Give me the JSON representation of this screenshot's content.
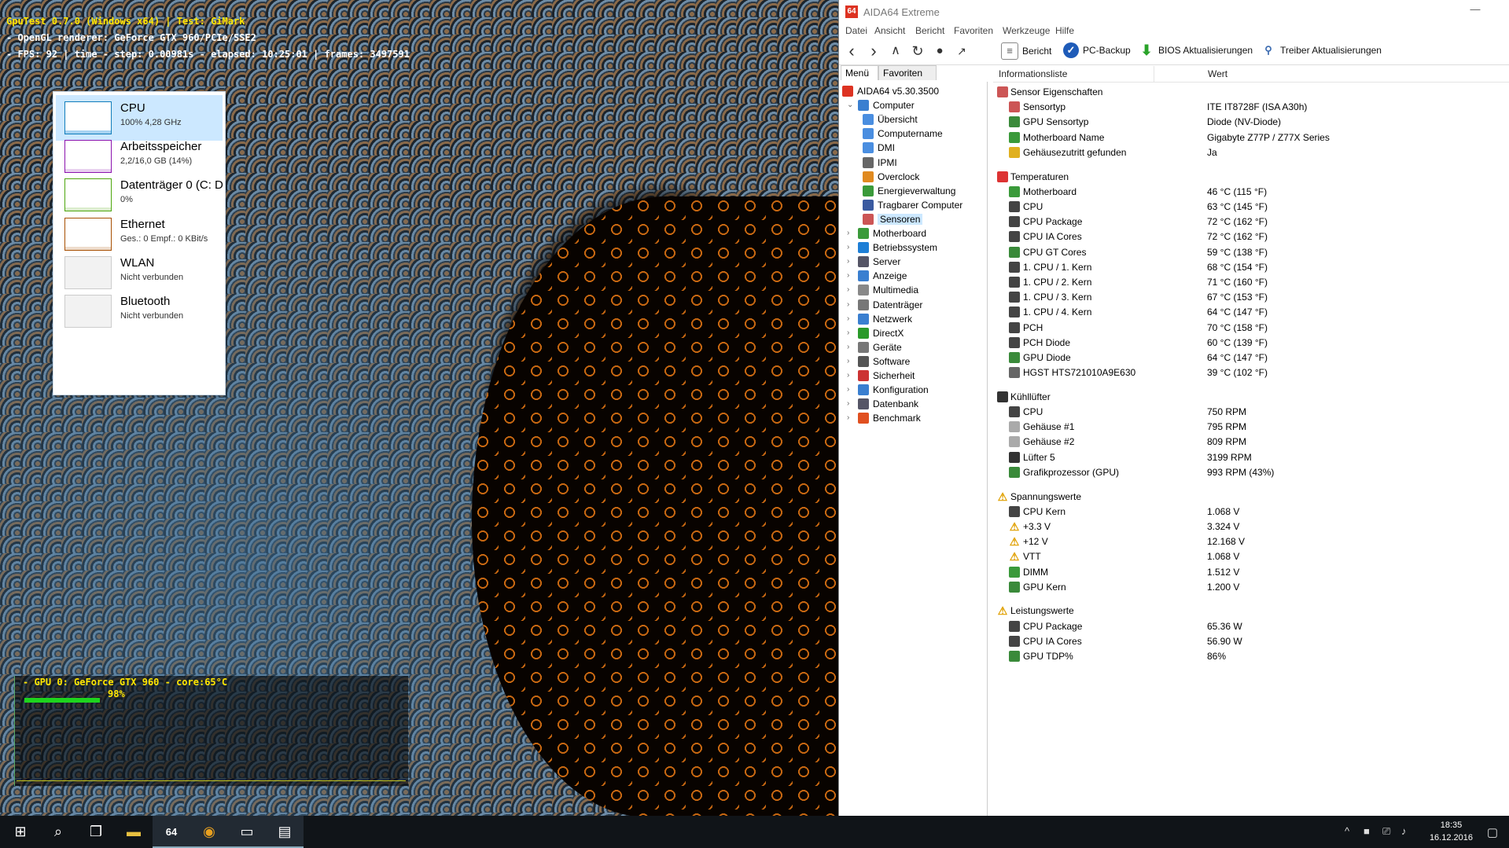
{
  "gputest": {
    "title": "GpuTest 0.7.0 (Windows x64) | Test: GiMark",
    "renderer": "- OpenGL renderer: GeForce GTX 960/PCIe/SSE2",
    "stats": "- FPS: 92 | time - step: 0.00981s - elapsed: 10:25:01 | frames: 3497591",
    "gpu_label": "- GPU 0: GeForce GTX 960 - core:65°C",
    "gpu_percent_text": "98%",
    "gpu_load": 0.98,
    "colors": {
      "osd_title": "#ffe600",
      "gpu_bar": "#1ed41e"
    }
  },
  "taskmgr": {
    "items": [
      {
        "name": "CPU",
        "sub": "100% 4,28 GHz",
        "color": "#117dbb",
        "selected": true
      },
      {
        "name": "Arbeitsspeicher",
        "sub": "2,2/16,0 GB (14%)",
        "color": "#8b12ae",
        "selected": false
      },
      {
        "name": "Datenträger 0 (C: D",
        "sub": "0%",
        "color": "#4da60c",
        "selected": false
      },
      {
        "name": "Ethernet",
        "sub": "Ges.: 0 Empf.: 0 KBit/s",
        "color": "#a74f01",
        "selected": false
      },
      {
        "name": "WLAN",
        "sub": "Nicht verbunden",
        "color": "#cccccc",
        "selected": false
      },
      {
        "name": "Bluetooth",
        "sub": "Nicht verbunden",
        "color": "#cccccc",
        "selected": false
      }
    ]
  },
  "aida": {
    "logo": "64",
    "title": "AIDA64 Extreme",
    "menu": [
      "Datei",
      "Ansicht",
      "Bericht",
      "Favoriten",
      "Werkzeuge",
      "Hilfe"
    ],
    "toolbar": {
      "report": "Bericht",
      "backup": "PC-Backup",
      "bios": "BIOS Aktualisierungen",
      "driver": "Treiber Aktualisierungen"
    },
    "tabs": {
      "menu": "Menü",
      "favorites": "Favoriten"
    },
    "tree": [
      {
        "label": "AIDA64 v5.30.3500",
        "level": 0,
        "icon": "aida64-icon",
        "color": "#d32"
      },
      {
        "label": "Computer",
        "level": 1,
        "icon": "computer-icon",
        "color": "#3a7fd0",
        "expanded": true
      },
      {
        "label": "Übersicht",
        "level": 2,
        "icon": "overview-icon",
        "color": "#4a8ee0"
      },
      {
        "label": "Computername",
        "level": 2,
        "icon": "computername-icon",
        "color": "#4a8ee0"
      },
      {
        "label": "DMI",
        "level": 2,
        "icon": "dmi-icon",
        "color": "#4a8ee0"
      },
      {
        "label": "IPMI",
        "level": 2,
        "icon": "ipmi-icon",
        "color": "#666"
      },
      {
        "label": "Overclock",
        "level": 2,
        "icon": "overclock-icon",
        "color": "#e08a20"
      },
      {
        "label": "Energieverwaltung",
        "level": 2,
        "icon": "power-icon",
        "color": "#3a9a3a"
      },
      {
        "label": "Tragbarer Computer",
        "level": 2,
        "icon": "laptop-icon",
        "color": "#3a5aa0"
      },
      {
        "label": "Sensoren",
        "level": 2,
        "icon": "sensor-icon",
        "color": "#c55",
        "selected": true
      },
      {
        "label": "Motherboard",
        "level": 1,
        "icon": "motherboard-icon",
        "color": "#3a9a3a"
      },
      {
        "label": "Betriebssystem",
        "level": 1,
        "icon": "windows-icon",
        "color": "#1e7fd6"
      },
      {
        "label": "Server",
        "level": 1,
        "icon": "server-icon",
        "color": "#556"
      },
      {
        "label": "Anzeige",
        "level": 1,
        "icon": "display-icon",
        "color": "#3a7fd0"
      },
      {
        "label": "Multimedia",
        "level": 1,
        "icon": "multimedia-icon",
        "color": "#888"
      },
      {
        "label": "Datenträger",
        "level": 1,
        "icon": "storage-icon",
        "color": "#777"
      },
      {
        "label": "Netzwerk",
        "level": 1,
        "icon": "network-icon",
        "color": "#3a7fd0"
      },
      {
        "label": "DirectX",
        "level": 1,
        "icon": "directx-icon",
        "color": "#2a9a2a"
      },
      {
        "label": "Geräte",
        "level": 1,
        "icon": "devices-icon",
        "color": "#777"
      },
      {
        "label": "Software",
        "level": 1,
        "icon": "software-icon",
        "color": "#555"
      },
      {
        "label": "Sicherheit",
        "level": 1,
        "icon": "security-icon",
        "color": "#c33"
      },
      {
        "label": "Konfiguration",
        "level": 1,
        "icon": "config-icon",
        "color": "#3a7fd0"
      },
      {
        "label": "Datenbank",
        "level": 1,
        "icon": "database-icon",
        "color": "#556"
      },
      {
        "label": "Benchmark",
        "level": 1,
        "icon": "benchmark-icon",
        "color": "#e05020"
      }
    ],
    "columns": {
      "field": "Informationsliste",
      "value": "Wert"
    },
    "sections": [
      {
        "title": "Sensor Eigenschaften",
        "icon": "sensor-icon",
        "color": "#c55",
        "rows": [
          {
            "name": "Sensortyp",
            "value": "ITE IT8728F  (ISA A30h)",
            "icon": "sensor-icon",
            "color": "#c55"
          },
          {
            "name": "GPU Sensortyp",
            "value": "Diode  (NV-Diode)",
            "icon": "gpu-icon",
            "color": "#3a8a3a"
          },
          {
            "name": "Motherboard Name",
            "value": "Gigabyte Z77P / Z77X Series",
            "icon": "motherboard-icon",
            "color": "#3a9a3a"
          },
          {
            "name": "Gehäusezutritt gefunden",
            "value": "Ja",
            "icon": "lock-icon",
            "color": "#e0b020"
          }
        ]
      },
      {
        "title": "Temperaturen",
        "icon": "thermometer-icon",
        "color": "#d33",
        "rows": [
          {
            "name": "Motherboard",
            "value": "46 °C  (115 °F)",
            "icon": "motherboard-icon",
            "color": "#3a9a3a"
          },
          {
            "name": "CPU",
            "value": "63 °C  (145 °F)",
            "icon": "cpu-icon",
            "color": "#444"
          },
          {
            "name": "CPU Package",
            "value": "72 °C  (162 °F)",
            "icon": "cpu-icon",
            "color": "#444"
          },
          {
            "name": "CPU IA Cores",
            "value": "72 °C  (162 °F)",
            "icon": "cpu-icon",
            "color": "#444"
          },
          {
            "name": "CPU GT Cores",
            "value": "59 °C  (138 °F)",
            "icon": "gpu-icon",
            "color": "#3a8a3a"
          },
          {
            "name": "1. CPU / 1. Kern",
            "value": "68 °C  (154 °F)",
            "icon": "cpu-icon",
            "color": "#444"
          },
          {
            "name": "1. CPU / 2. Kern",
            "value": "71 °C  (160 °F)",
            "icon": "cpu-icon",
            "color": "#444"
          },
          {
            "name": "1. CPU / 3. Kern",
            "value": "67 °C  (153 °F)",
            "icon": "cpu-icon",
            "color": "#444"
          },
          {
            "name": "1. CPU / 4. Kern",
            "value": "64 °C  (147 °F)",
            "icon": "cpu-icon",
            "color": "#444"
          },
          {
            "name": "PCH",
            "value": "70 °C  (158 °F)",
            "icon": "chip-icon",
            "color": "#444"
          },
          {
            "name": "PCH Diode",
            "value": "60 °C  (139 °F)",
            "icon": "chip-icon",
            "color": "#444"
          },
          {
            "name": "GPU Diode",
            "value": "64 °C  (147 °F)",
            "icon": "gpu-icon",
            "color": "#3a8a3a"
          },
          {
            "name": "HGST HTS721010A9E630",
            "value": "39 °C  (102 °F)",
            "icon": "harddisk-icon",
            "color": "#666"
          }
        ]
      },
      {
        "title": "Kühllüfter",
        "icon": "fan-icon",
        "color": "#333",
        "rows": [
          {
            "name": "CPU",
            "value": "750 RPM",
            "icon": "cpu-icon",
            "color": "#444"
          },
          {
            "name": "Gehäuse #1",
            "value": "795 RPM",
            "icon": "case-icon",
            "color": "#aaa"
          },
          {
            "name": "Gehäuse #2",
            "value": "809 RPM",
            "icon": "case-icon",
            "color": "#aaa"
          },
          {
            "name": "Lüfter 5",
            "value": "3199 RPM",
            "icon": "fan-icon",
            "color": "#333"
          },
          {
            "name": "Grafikprozessor (GPU)",
            "value": "993 RPM  (43%)",
            "icon": "gpu-icon",
            "color": "#3a8a3a"
          }
        ]
      },
      {
        "title": "Spannungswerte",
        "icon": "warning-icon",
        "color": "#e0a000",
        "rows": [
          {
            "name": "CPU Kern",
            "value": "1.068 V",
            "icon": "cpu-icon",
            "color": "#444"
          },
          {
            "name": "+3.3 V",
            "value": "3.324 V",
            "icon": "warning-icon",
            "color": "#e0a000"
          },
          {
            "name": "+12 V",
            "value": "12.168 V",
            "icon": "warning-icon",
            "color": "#e0a000"
          },
          {
            "name": "VTT",
            "value": "1.068 V",
            "icon": "warning-icon",
            "color": "#e0a000"
          },
          {
            "name": "DIMM",
            "value": "1.512 V",
            "icon": "memory-icon",
            "color": "#3a9a3a"
          },
          {
            "name": "GPU Kern",
            "value": "1.200 V",
            "icon": "gpu-icon",
            "color": "#3a8a3a"
          }
        ]
      },
      {
        "title": "Leistungswerte",
        "icon": "warning-icon",
        "color": "#e0a000",
        "rows": [
          {
            "name": "CPU Package",
            "value": "65.36 W",
            "icon": "cpu-icon",
            "color": "#444"
          },
          {
            "name": "CPU IA Cores",
            "value": "56.90 W",
            "icon": "cpu-icon",
            "color": "#444"
          },
          {
            "name": "GPU TDP%",
            "value": "86%",
            "icon": "gpu-icon",
            "color": "#3a8a3a"
          }
        ]
      }
    ]
  },
  "taskbar": {
    "time": "18:35",
    "date": "16.12.2016",
    "apps": [
      {
        "name": "start-button",
        "glyph": "⊞"
      },
      {
        "name": "search-button",
        "glyph": "⌕"
      },
      {
        "name": "task-view-button",
        "glyph": "❐"
      },
      {
        "name": "file-explorer-button",
        "glyph": "▬"
      },
      {
        "name": "aida64-taskbar-button",
        "glyph": "64"
      },
      {
        "name": "gputest-taskbar-button",
        "glyph": "◉"
      },
      {
        "name": "window-taskbar-button",
        "glyph": "▭"
      },
      {
        "name": "taskmgr-taskbar-button",
        "glyph": "▤"
      }
    ],
    "tray": [
      "^",
      "■",
      "⎚",
      "♪"
    ]
  }
}
